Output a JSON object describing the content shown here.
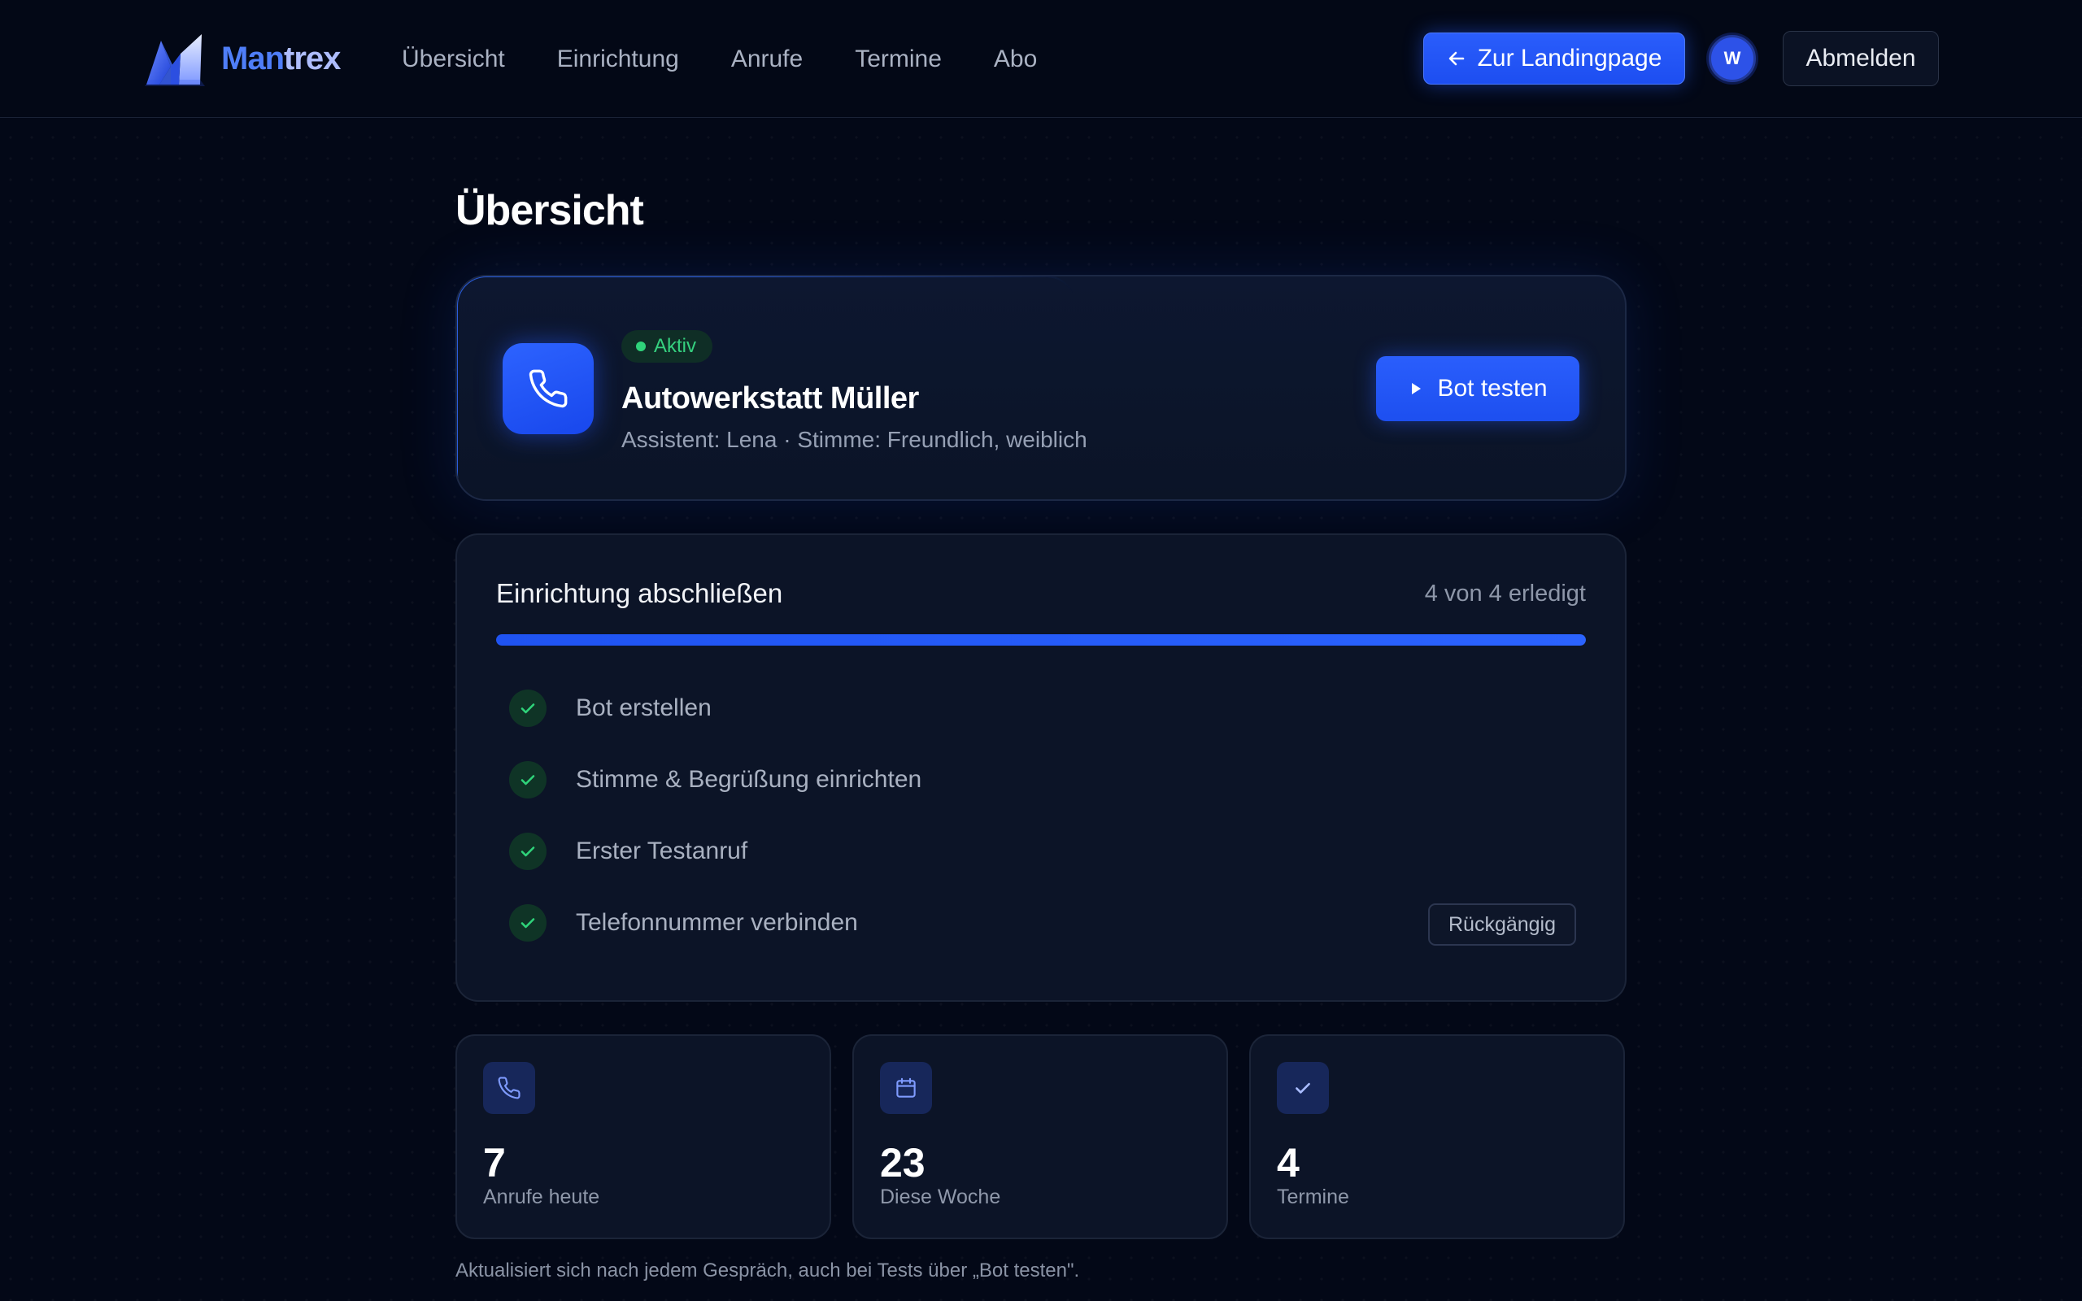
{
  "header": {
    "brand": {
      "part1": "Man",
      "part2": "trex"
    },
    "nav": [
      "Übersicht",
      "Einrichtung",
      "Anrufe",
      "Termine",
      "Abo"
    ],
    "landing_button": "Zur Landingpage",
    "avatar_initial": "W",
    "logout_button": "Abmelden"
  },
  "page": {
    "title": "Übersicht"
  },
  "bot": {
    "status": "Aktiv",
    "name": "Autowerkstatt Müller",
    "subtitle": "Assistent: Lena · Stimme: Freundlich, weiblich",
    "test_button": "Bot testen"
  },
  "setup": {
    "title": "Einrichtung abschließen",
    "progress_text": "4 von 4 erledigt",
    "progress_fraction": 1.0,
    "steps": [
      {
        "label": "Bot erstellen"
      },
      {
        "label": "Stimme & Begrüßung einrichten"
      },
      {
        "label": "Erster Testanruf"
      },
      {
        "label": "Telefonnummer verbinden",
        "action": "Rückgängig"
      }
    ]
  },
  "stats": [
    {
      "icon": "phone-icon",
      "value": "7",
      "label": "Anrufe heute"
    },
    {
      "icon": "calendar-icon",
      "value": "23",
      "label": "Diese Woche"
    },
    {
      "icon": "check-icon",
      "value": "4",
      "label": "Termine"
    }
  ],
  "footnote": "Aktualisiert sich nach jedem Gespräch, auch bei Tests über „Bot testen\".",
  "colors": {
    "background": "#030817",
    "accent": "#1f53f2",
    "success": "#2fd37a",
    "card": "#0c1427"
  }
}
